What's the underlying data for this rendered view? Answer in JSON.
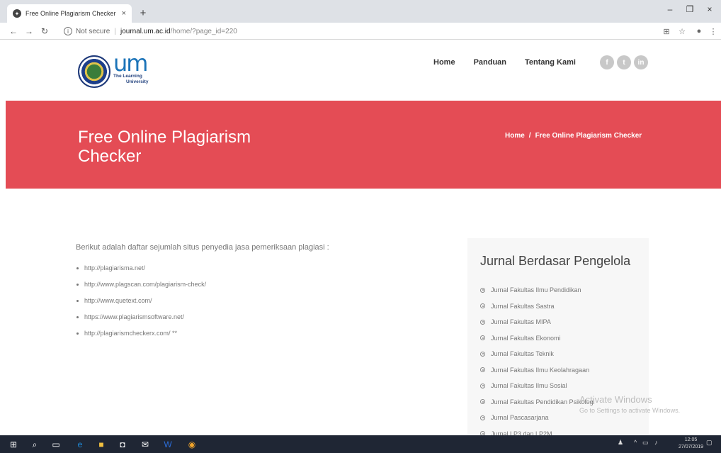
{
  "browser": {
    "tab_title": "Free Online Plagiarism Checker - ",
    "tab_close": "×",
    "new_tab": "+",
    "minimize": "–",
    "maximize": "❐",
    "close": "×",
    "not_secure": "Not secure",
    "url_host": "journal.um.ac.id",
    "url_path": "/home/?page_id=220"
  },
  "logo": {
    "mark": "um",
    "tagline_1": "The Learning",
    "tagline_2": "University"
  },
  "nav": {
    "items": [
      "Home",
      "Panduan",
      "Tentang Kami"
    ]
  },
  "social": {
    "icons": [
      "facebook-icon",
      "twitter-icon",
      "linkedin-icon"
    ],
    "labels": [
      "f",
      "t",
      "in"
    ]
  },
  "hero": {
    "title": "Free Online Plagiarism Checker",
    "breadcrumb_home": "Home",
    "breadcrumb_sep": "/",
    "breadcrumb_current": "Free Online Plagiarism Checker",
    "bg_color": "#e44c55"
  },
  "content": {
    "intro": "Berikut adalah daftar sejumlah situs penyedia jasa pemeriksaan plagiasi :",
    "sites": [
      "http://plagiarisma.net/",
      "http://www.plagscan.com/plagiarism-check/",
      "http://www.quetext.com/",
      "https://www.plagiarismsoftware.net/",
      "http://plagiarismcheckerx.com/ **"
    ]
  },
  "sidebar": {
    "title": "Jurnal Berdasar Pengelola",
    "items": [
      "Jurnal Fakultas Ilmu Pendidikan",
      "Jurnal Fakultas Sastra",
      "Jurnal Fakultas MIPA",
      "Jurnal Fakultas Ekonomi",
      "Jurnal Fakultas Teknik",
      "Jurnal Fakultas Ilmu Keolahragaan",
      "Jurnal Fakultas Ilmu Sosial",
      "Jurnal Fakultas Pendidikan Psikologi",
      "Jurnal Pascasarjana",
      "Jurnal LP3 dan LP2M"
    ]
  },
  "watermark": {
    "line1": "Activate Windows",
    "line2": "Go to Settings to activate Windows."
  },
  "taskbar": {
    "time": "12:05",
    "date": "27/07/2019"
  }
}
